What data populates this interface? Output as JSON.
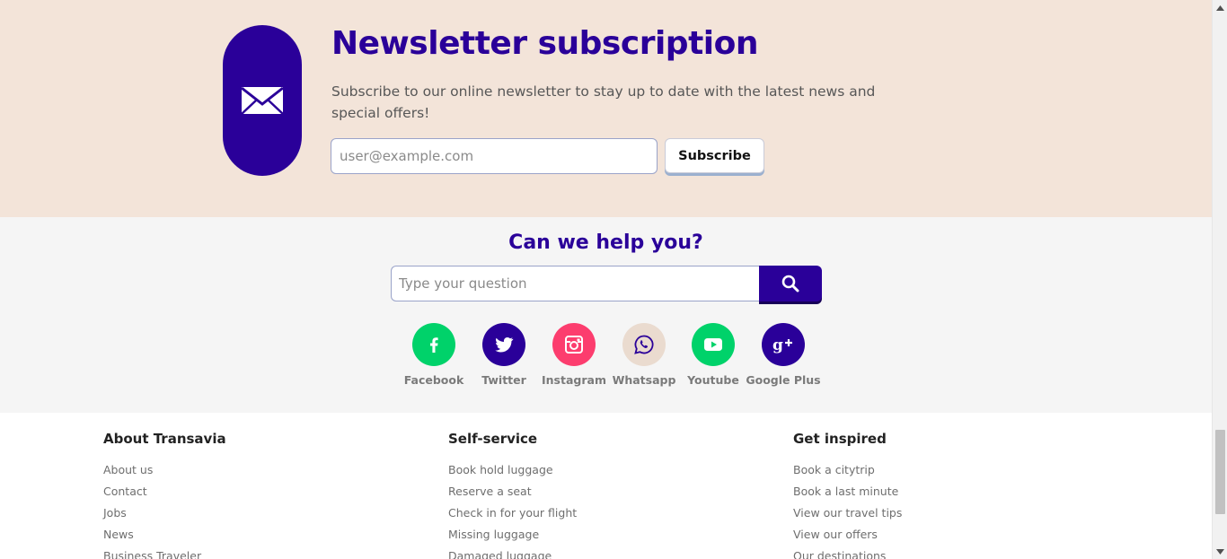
{
  "newsletter": {
    "title": "Newsletter subscription",
    "description": "Subscribe to our online newsletter to stay up to date with the latest news and special offers!",
    "email_placeholder": "user@example.com",
    "subscribe_label": "Subscribe",
    "icon": "envelope-icon"
  },
  "help": {
    "title": "Can we help you?",
    "search_placeholder": "Type your question",
    "search_icon": "search-icon"
  },
  "social": [
    {
      "label": "Facebook",
      "icon": "facebook-icon",
      "color": "#00d26a"
    },
    {
      "label": "Twitter",
      "icon": "twitter-icon",
      "color": "#2a0099"
    },
    {
      "label": "Instagram",
      "icon": "instagram-icon",
      "color": "#fc3d6e"
    },
    {
      "label": "Whatsapp",
      "icon": "whatsapp-icon",
      "color": "#eadbcf"
    },
    {
      "label": "Youtube",
      "icon": "youtube-icon",
      "color": "#00d26a"
    },
    {
      "label": "Google Plus",
      "icon": "google-plus-icon",
      "color": "#2a0099"
    }
  ],
  "footer": {
    "columns": [
      {
        "title": "About Transavia",
        "links": [
          "About us",
          "Contact",
          "Jobs",
          "News",
          "Business Traveler"
        ]
      },
      {
        "title": "Self-service",
        "links": [
          "Book hold luggage",
          "Reserve a seat",
          "Check in for your flight",
          "Missing luggage",
          "Damaged luggage"
        ]
      },
      {
        "title": "Get inspired",
        "links": [
          "Book a citytrip",
          "Book a last minute",
          "View our travel tips",
          "View our offers",
          "Our destinations"
        ]
      }
    ]
  },
  "colors": {
    "brand": "#2a0099",
    "newsletter_bg": "#f3e4d9",
    "help_bg": "#f5f5f5",
    "green": "#00d26a",
    "pink": "#fc3d6e"
  }
}
